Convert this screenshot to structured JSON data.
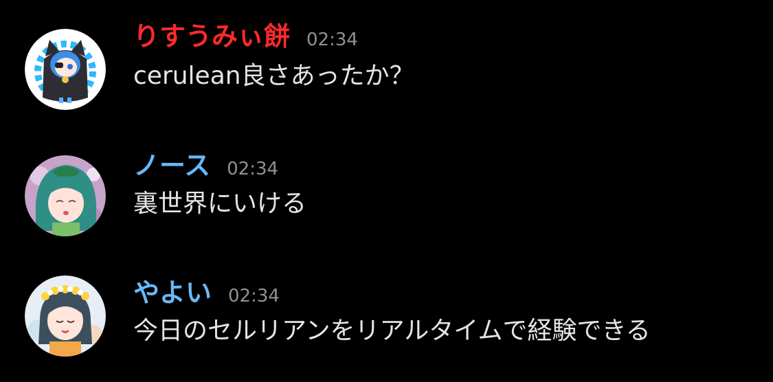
{
  "messages": [
    {
      "username": "りすうみぃ餅",
      "username_color": "#ff2a2a",
      "timestamp": "02:34",
      "text": "cerulean良さあったか？",
      "avatar": "avatar-cat-hood"
    },
    {
      "username": "ノース",
      "username_color": "#6ab8f7",
      "timestamp": "02:34",
      "text": "裏世界にいける",
      "avatar": "avatar-green-hair"
    },
    {
      "username": "やよい",
      "username_color": "#6ab8f7",
      "timestamp": "02:34",
      "text": "今日のセルリアンをリアルタイムで経験できる",
      "avatar": "avatar-flower-crown"
    }
  ],
  "colors": {
    "background": "#000000",
    "timestamp": "#8e9297",
    "message_text": "#e3e5e8"
  }
}
